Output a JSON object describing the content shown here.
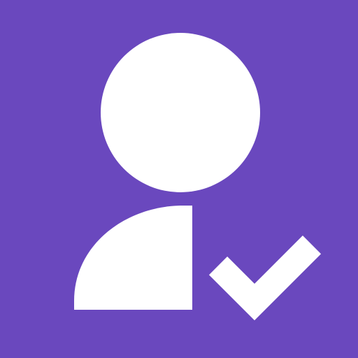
{
  "icon": {
    "name": "user-check-icon",
    "background_color": "#6a48be",
    "foreground_color": "#ffffff"
  }
}
